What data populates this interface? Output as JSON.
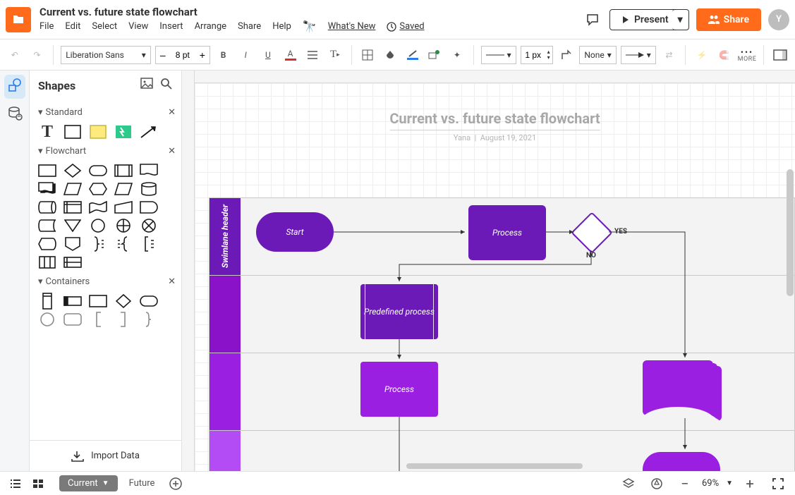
{
  "header": {
    "doc_title": "Current vs. future state flowchart",
    "menus": [
      "File",
      "Edit",
      "Select",
      "View",
      "Insert",
      "Arrange",
      "Share",
      "Help"
    ],
    "whats_new": "What's New",
    "saved": "Saved",
    "present": "Present",
    "share": "Share",
    "avatar_initial": "Y"
  },
  "toolbar": {
    "font_name": "Liberation Sans",
    "font_size": "8 pt",
    "line_width": "1 px",
    "fill_label": "None",
    "more": "MORE"
  },
  "sidebar": {
    "title": "Shapes",
    "categories": [
      {
        "name": "Standard"
      },
      {
        "name": "Flowchart"
      },
      {
        "name": "Containers"
      }
    ],
    "import": "Import Data"
  },
  "canvas": {
    "title": "Current vs. future state flowchart",
    "sub_author": "Yana",
    "sub_sep": "|",
    "sub_date": "August 19, 2021",
    "swimlane_header": "Swimlane header",
    "nodes": {
      "start": "Start",
      "process_top": "Process",
      "predef": "Predefined process",
      "process_mid": "Process",
      "yes": "YES",
      "no": "NO"
    }
  },
  "bottom": {
    "tabs": [
      {
        "label": "Current",
        "active": true
      },
      {
        "label": "Future",
        "active": false
      }
    ],
    "zoom": "69%"
  }
}
